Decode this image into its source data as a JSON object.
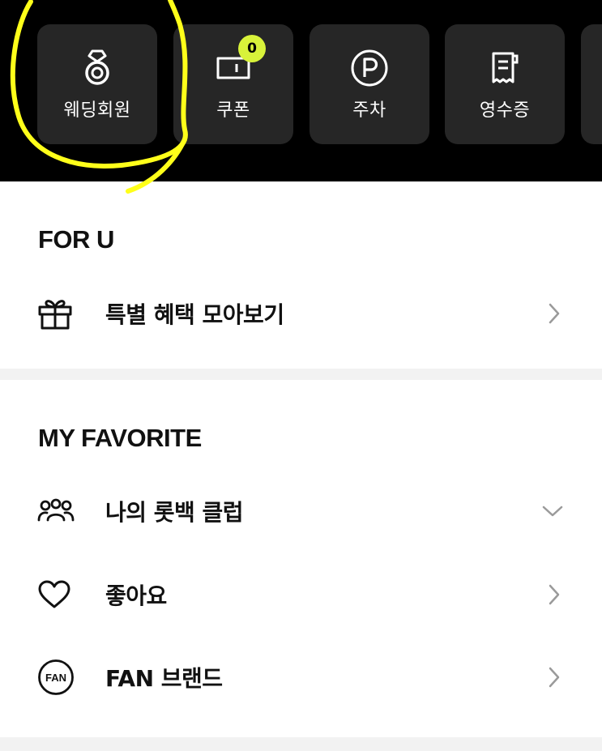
{
  "quick_menu": {
    "items": [
      {
        "label": "웨딩회원",
        "icon": "wedding-ring-icon"
      },
      {
        "label": "쿠폰",
        "icon": "coupon-icon",
        "badge": "0"
      },
      {
        "label": "주차",
        "icon": "parking-icon"
      },
      {
        "label": "영수증",
        "icon": "receipt-icon"
      }
    ]
  },
  "for_u": {
    "title": "FOR U",
    "items": [
      {
        "label": "특별 혜택 모아보기",
        "icon": "gift-icon"
      }
    ]
  },
  "my_favorite": {
    "title": "MY FAVORITE",
    "items": [
      {
        "label": "나의 롯백 클럽",
        "icon": "group-icon",
        "expanded": false
      },
      {
        "label": "좋아요",
        "icon": "heart-icon"
      },
      {
        "label": "FAN 브랜드",
        "icon": "fan-icon",
        "icon_text": "FAN"
      }
    ]
  },
  "colors": {
    "top_background": "#000000",
    "tile_background": "#262626",
    "badge": "#d8f23a",
    "highlight_marker": "#ffff1a",
    "divider": "#f2f2f2"
  }
}
